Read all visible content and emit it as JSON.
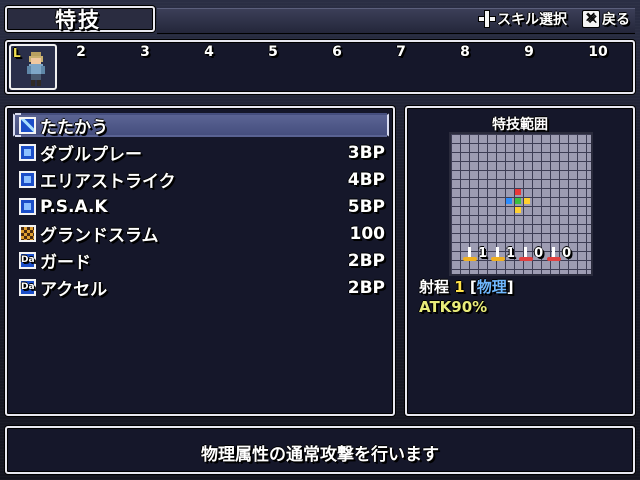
{
  "header": {
    "title": "特技",
    "hints": [
      {
        "icon": "dpad-icon",
        "label": "スキル選択"
      },
      {
        "icon": "x-button-icon",
        "label": "戻る"
      }
    ]
  },
  "party": {
    "leader_marker": "L",
    "slots": [
      "2",
      "3",
      "4",
      "5",
      "6",
      "7",
      "8",
      "9",
      "10"
    ]
  },
  "skills": [
    {
      "name": "たたかう",
      "cost": "",
      "icon": "sword-icon",
      "selected": true
    },
    {
      "name": "ダブルプレー",
      "cost": "3BP",
      "icon": "blue-square-icon",
      "selected": false
    },
    {
      "name": "エリアストライク",
      "cost": "4BP",
      "icon": "blue-square-icon",
      "selected": false
    },
    {
      "name": "P.S.A.K",
      "cost": "5BP",
      "icon": "blue-square-icon",
      "selected": false
    },
    {
      "name": "グランドスラム",
      "cost": "100",
      "icon": "checker-icon",
      "selected": false
    },
    {
      "name": "ガード",
      "cost": "2BP",
      "icon": "da-icon",
      "selected": false
    },
    {
      "name": "アクセル",
      "cost": "2BP",
      "icon": "da-icon",
      "selected": false
    }
  ],
  "icon_text": {
    "da": "Da"
  },
  "range": {
    "title": "特技範囲",
    "elevation": [
      {
        "dir": "up",
        "value": "1"
      },
      {
        "dir": "down",
        "value": "1"
      },
      {
        "dir": "up",
        "value": "0"
      },
      {
        "dir": "down",
        "value": "0"
      }
    ],
    "range_label": "射程",
    "range_value": "1",
    "type_open": "[",
    "type": "物理",
    "type_close": "]",
    "effect": "ATK90%"
  },
  "description": "物理属性の通常攻撃を行います",
  "colors": {
    "panel_bg": "#15172a",
    "border": "#e8e8f0",
    "selection": "#4f5888",
    "range_center_red": "#e83838",
    "range_blue": "#2a8cff",
    "range_green": "#3ac040",
    "range_yellow": "#ffd030"
  }
}
